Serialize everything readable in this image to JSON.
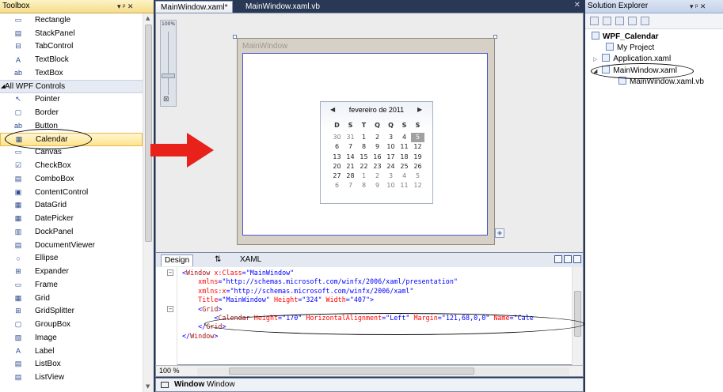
{
  "toolbox": {
    "title": "Toolbox",
    "pin_label": "▾ ᵖ ✕",
    "items": [
      {
        "label": "Rectangle",
        "icon": "rectangle-icon",
        "glyph": "▭"
      },
      {
        "label": "StackPanel",
        "icon": "stackpanel-icon",
        "glyph": "▤"
      },
      {
        "label": "TabControl",
        "icon": "tabcontrol-icon",
        "glyph": "⊟"
      },
      {
        "label": "TextBlock",
        "icon": "textblock-icon",
        "glyph": "A"
      },
      {
        "label": "TextBox",
        "icon": "textbox-icon",
        "glyph": "ab"
      },
      {
        "label": "All WPF Controls",
        "section": true
      },
      {
        "label": "Pointer",
        "icon": "pointer-icon",
        "glyph": "↖"
      },
      {
        "label": "Border",
        "icon": "border-icon",
        "glyph": "▢"
      },
      {
        "label": "Button",
        "icon": "button-icon",
        "glyph": "ab"
      },
      {
        "label": "Calendar",
        "icon": "calendar-icon",
        "glyph": "▦",
        "selected": true
      },
      {
        "label": "Canvas",
        "icon": "canvas-icon",
        "glyph": "▭"
      },
      {
        "label": "CheckBox",
        "icon": "checkbox-icon",
        "glyph": "☑"
      },
      {
        "label": "ComboBox",
        "icon": "combobox-icon",
        "glyph": "▤"
      },
      {
        "label": "ContentControl",
        "icon": "contentcontrol-icon",
        "glyph": "▣"
      },
      {
        "label": "DataGrid",
        "icon": "datagrid-icon",
        "glyph": "▦"
      },
      {
        "label": "DatePicker",
        "icon": "datepicker-icon",
        "glyph": "▦"
      },
      {
        "label": "DockPanel",
        "icon": "dockpanel-icon",
        "glyph": "▥"
      },
      {
        "label": "DocumentViewer",
        "icon": "documentviewer-icon",
        "glyph": "▤"
      },
      {
        "label": "Ellipse",
        "icon": "ellipse-icon",
        "glyph": "○"
      },
      {
        "label": "Expander",
        "icon": "expander-icon",
        "glyph": "⊞"
      },
      {
        "label": "Frame",
        "icon": "frame-icon",
        "glyph": "▭"
      },
      {
        "label": "Grid",
        "icon": "grid-icon",
        "glyph": "▦"
      },
      {
        "label": "GridSplitter",
        "icon": "gridsplitter-icon",
        "glyph": "⊞"
      },
      {
        "label": "GroupBox",
        "icon": "groupbox-icon",
        "glyph": "▢"
      },
      {
        "label": "Image",
        "icon": "image-icon",
        "glyph": "▨"
      },
      {
        "label": "Label",
        "icon": "label-icon",
        "glyph": "A"
      },
      {
        "label": "ListBox",
        "icon": "listbox-icon",
        "glyph": "▤"
      },
      {
        "label": "ListView",
        "icon": "listview-icon",
        "glyph": "▤"
      }
    ],
    "partial_top_label": "Rectangle"
  },
  "editor": {
    "tabs": [
      {
        "label": "MainWindow.xaml*",
        "active": true
      },
      {
        "label": "MainWindow.xaml.vb",
        "active": false
      }
    ],
    "tab_close": "✕",
    "zoom_percent": "100%",
    "window_caption": "MainWindow",
    "calendar": {
      "month_label": "fevereiro de 2011",
      "prev": "◀",
      "next": "▶",
      "weekdays": [
        "D",
        "S",
        "T",
        "Q",
        "Q",
        "S",
        "S"
      ],
      "weeks": [
        [
          "30",
          "31",
          "1",
          "2",
          "3",
          "4",
          "5"
        ],
        [
          "6",
          "7",
          "8",
          "9",
          "10",
          "11",
          "12"
        ],
        [
          "13",
          "14",
          "15",
          "16",
          "17",
          "18",
          "19"
        ],
        [
          "20",
          "21",
          "22",
          "23",
          "24",
          "25",
          "26"
        ],
        [
          "27",
          "28",
          "1",
          "2",
          "3",
          "4",
          "5"
        ],
        [
          "6",
          "7",
          "8",
          "9",
          "10",
          "11",
          "12"
        ]
      ]
    },
    "view_tabs": {
      "design": "Design",
      "swap": "⇅",
      "xaml": "XAML"
    },
    "xaml_lines": [
      [
        {
          "c": "br",
          "t": "<"
        },
        {
          "c": "tg",
          "t": "Window"
        },
        {
          "c": "at",
          "t": " x:Class"
        },
        {
          "c": "br",
          "t": "=\"MainWindow\""
        }
      ],
      [
        {
          "c": "at",
          "t": "    xmlns"
        },
        {
          "c": "br",
          "t": "=\"http://schemas.microsoft.com/winfx/2006/xaml/presentation\""
        }
      ],
      [
        {
          "c": "at",
          "t": "    xmlns:x"
        },
        {
          "c": "br",
          "t": "=\"http://schemas.microsoft.com/winfx/2006/xaml\""
        }
      ],
      [
        {
          "c": "at",
          "t": "    Title"
        },
        {
          "c": "br",
          "t": "=\"MainWindow\""
        },
        {
          "c": "at",
          "t": " Height"
        },
        {
          "c": "br",
          "t": "=\"324\""
        },
        {
          "c": "at",
          "t": " Width"
        },
        {
          "c": "br",
          "t": "=\"407\">"
        }
      ],
      [
        {
          "c": "br",
          "t": "    <"
        },
        {
          "c": "tg",
          "t": "Grid"
        },
        {
          "c": "br",
          "t": ">"
        }
      ],
      [
        {
          "c": "br",
          "t": "        <"
        },
        {
          "c": "tg",
          "t": "Calendar"
        },
        {
          "c": "at",
          "t": " Height"
        },
        {
          "c": "br",
          "t": "=\"170\""
        },
        {
          "c": "at",
          "t": " HorizontalAlignment"
        },
        {
          "c": "br",
          "t": "=\"Left\""
        },
        {
          "c": "at",
          "t": " Margin"
        },
        {
          "c": "br",
          "t": "=\"121,68,0,0\""
        },
        {
          "c": "at",
          "t": " Name"
        },
        {
          "c": "br",
          "t": "=\"Cale"
        }
      ],
      [
        {
          "c": "br",
          "t": "    </"
        },
        {
          "c": "tg",
          "t": "Grid"
        },
        {
          "c": "br",
          "t": ">"
        }
      ],
      [
        {
          "c": "br",
          "t": "</"
        },
        {
          "c": "tg",
          "t": "Window"
        },
        {
          "c": "br",
          "t": ">"
        }
      ]
    ],
    "xaml_zoom": "100 %",
    "breadcrumb": [
      "Window",
      "Window"
    ]
  },
  "solution": {
    "title": "Solution Explorer",
    "controls": "▾ ᵖ ✕",
    "project": "WPF_Calendar",
    "items": [
      "My Project",
      "Application.xaml",
      "MainWindow.xaml",
      "MainWindow.xaml.vb"
    ]
  },
  "colors": {
    "annotation_arrow": "#e8211a",
    "selection_outline": "#4b55c6"
  }
}
